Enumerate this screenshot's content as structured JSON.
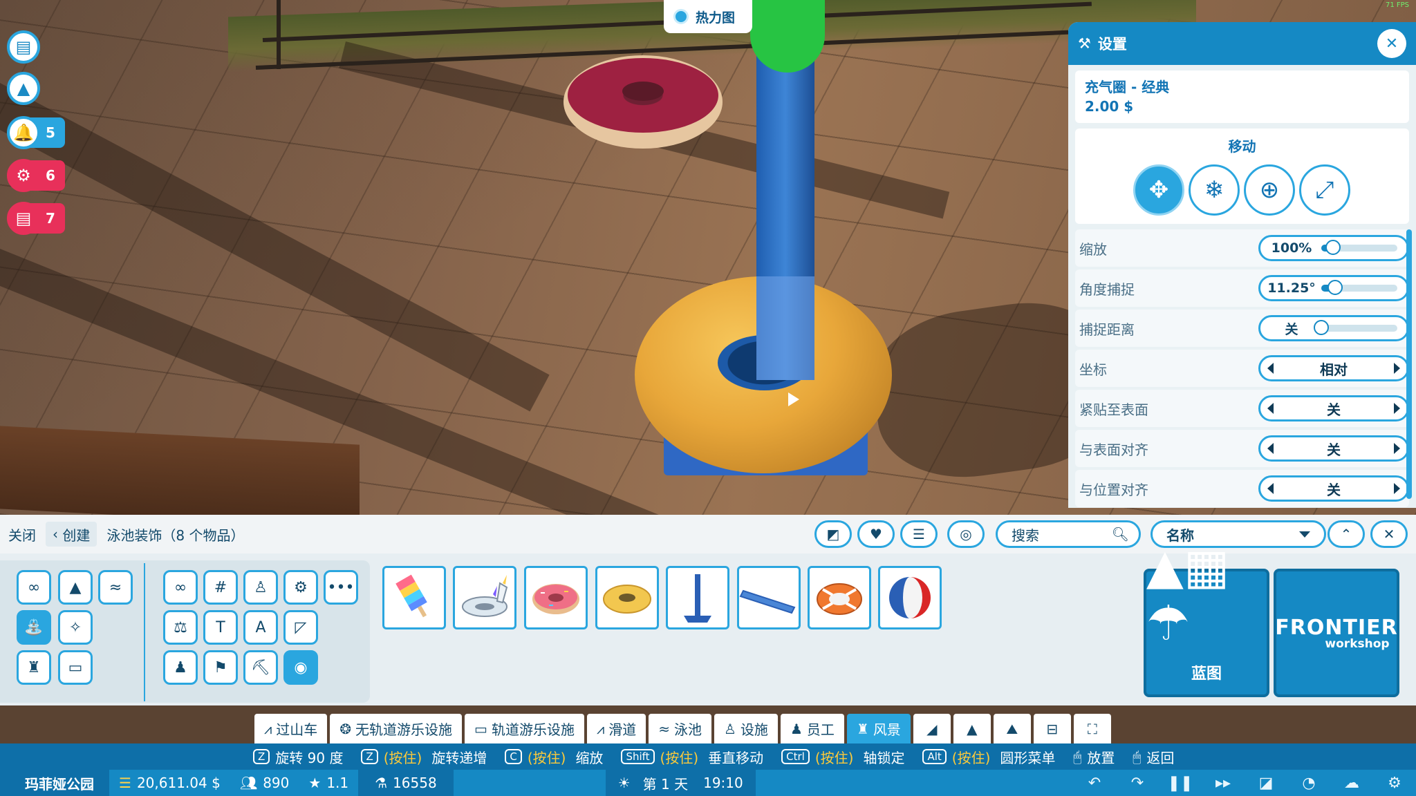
{
  "overlay": {
    "heatmap_label": "热力图",
    "fps": "71 FPS"
  },
  "left_buttons": [
    {
      "icon": "clipboard-icon",
      "count": ""
    },
    {
      "icon": "add-shapes-icon",
      "count": ""
    },
    {
      "icon": "bell-icon",
      "count": "5"
    },
    {
      "icon": "gear-alert-icon",
      "count": "6"
    },
    {
      "icon": "clipboard-alert-icon",
      "count": "7"
    }
  ],
  "settings": {
    "title": "设置",
    "item_name": "充气圈 - 经典",
    "item_price": "2.00 $",
    "move_label": "移动",
    "move_buttons": [
      "move-arrows-icon",
      "snowflake-icon",
      "rotate-axes-icon",
      "scale-icon"
    ],
    "rows": [
      {
        "label": "缩放",
        "value": "100%",
        "type": "slider",
        "level": 0.15
      },
      {
        "label": "角度捕捉",
        "value": "11.25°",
        "type": "slider",
        "level": 0.18
      },
      {
        "label": "捕捉距离",
        "value": "关",
        "type": "slider",
        "level": 0.0
      },
      {
        "label": "坐标",
        "value": "相对",
        "type": "select"
      },
      {
        "label": "紧贴至表面",
        "value": "关",
        "type": "select"
      },
      {
        "label": "与表面对齐",
        "value": "关",
        "type": "select"
      },
      {
        "label": "与位置对齐",
        "value": "关",
        "type": "select"
      }
    ]
  },
  "toolbar": {
    "close_label": "关闭",
    "back_label": "创建",
    "title": "泳池装饰（8 个物品）",
    "search_placeholder": "搜索",
    "sort_value": "名称"
  },
  "items": [
    "popsicle-float",
    "unicorn-float",
    "donut-float",
    "ring-float-classic",
    "pole",
    "pool-noodle",
    "lifebuoy",
    "beach-ball"
  ],
  "blueprint_label": "蓝图",
  "workshop_label": "FRONTIER",
  "workshop_sub": "workshop",
  "tabs": [
    {
      "label": "过山车",
      "icon": "coaster-icon"
    },
    {
      "label": "无轨道游乐设施",
      "icon": "flat-ride-icon"
    },
    {
      "label": "轨道游乐设施",
      "icon": "track-ride-icon"
    },
    {
      "label": "滑道",
      "icon": "slide-icon"
    },
    {
      "label": "泳池",
      "icon": "swimmer-icon"
    },
    {
      "label": "设施",
      "icon": "facilities-icon"
    },
    {
      "label": "员工",
      "icon": "staff-icon"
    },
    {
      "label": "风景",
      "icon": "castle-icon"
    }
  ],
  "hints": [
    {
      "key": "Z",
      "hold": "",
      "action": "旋转 90 度"
    },
    {
      "key": "Z",
      "hold": "(按住)",
      "action": "旋转递增"
    },
    {
      "key": "C",
      "hold": "(按住)",
      "action": "缩放"
    },
    {
      "key": "Shift",
      "hold": "(按住)",
      "action": "垂直移动"
    },
    {
      "key": "Ctrl",
      "hold": "(按住)",
      "action": "轴锁定"
    },
    {
      "key": "Alt",
      "hold": "(按住)",
      "action": "圆形菜单"
    },
    {
      "key": "🖱",
      "hold": "",
      "action": "放置"
    },
    {
      "key": "🖱",
      "hold": "",
      "action": "返回"
    }
  ],
  "status": {
    "park_name": "玛菲娅公园",
    "money": "20,611.04 $",
    "guests": "890",
    "rating": "1.1",
    "research": "16558",
    "day": "第 1 天",
    "time": "19:10"
  },
  "colors": {
    "accent": "#2aa6df",
    "header": "#1589c4",
    "alert": "#e8305a",
    "hold": "#ffcb3a"
  }
}
